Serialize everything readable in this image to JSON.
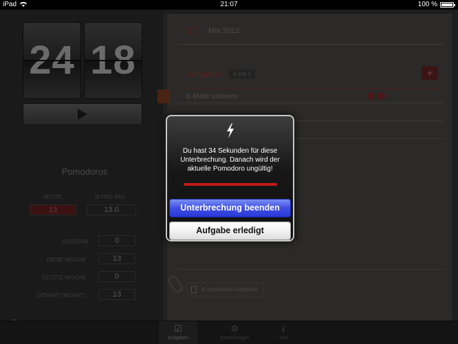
{
  "status_bar": {
    "device": "iPad",
    "wifi_icon": "wifi-icon",
    "time": "21:07",
    "battery_text": "100 %",
    "battery_level": 1.0
  },
  "timer": {
    "minutes": "24",
    "seconds": "18",
    "play_icon": "play-icon"
  },
  "pomodoros": {
    "title": "Pomodoros",
    "today_label": "HEUTE",
    "today_value": "13",
    "avg_label": "Ø PRO TAG",
    "avg_value": "13.0",
    "stats": [
      {
        "label": "GESTERN",
        "value": "0"
      },
      {
        "label": "DIESE WOCHE",
        "value": "13"
      },
      {
        "label": "LETZTE WOCHE",
        "value": "0"
      },
      {
        "label": "GESAMT (MONAT)",
        "value": "13"
      }
    ],
    "help_label": "?"
  },
  "notebook": {
    "day": "07",
    "month_year": "Mai 2012",
    "tasks_title": "Aufgaben",
    "tasks_count": "1 von 1",
    "add_label": "+",
    "task_items": [
      {
        "title": "E-Mails sortieren"
      }
    ],
    "unplanned_count": "4",
    "unplanned_label": "ungeplante Aufgaben"
  },
  "tabbar": {
    "tabs": [
      {
        "label": "Aufgaben",
        "icon": "checklist-icon"
      },
      {
        "label": "Einstellungen",
        "icon": "gear-icon"
      },
      {
        "label": "Info",
        "icon": "info-icon"
      }
    ]
  },
  "modal": {
    "icon": "lightning-icon",
    "message": "Du hast 34 Sekunden für diese Unterbrechung. Danach wird der aktuelle Pomodoro ungültig!",
    "progress": 1.0,
    "end_interruption_label": "Unterbrechung beenden",
    "task_done_label": "Aufgabe erledigt"
  },
  "colors": {
    "accent_red": "#c21a1a",
    "button_blue": "#3f4ee3"
  }
}
